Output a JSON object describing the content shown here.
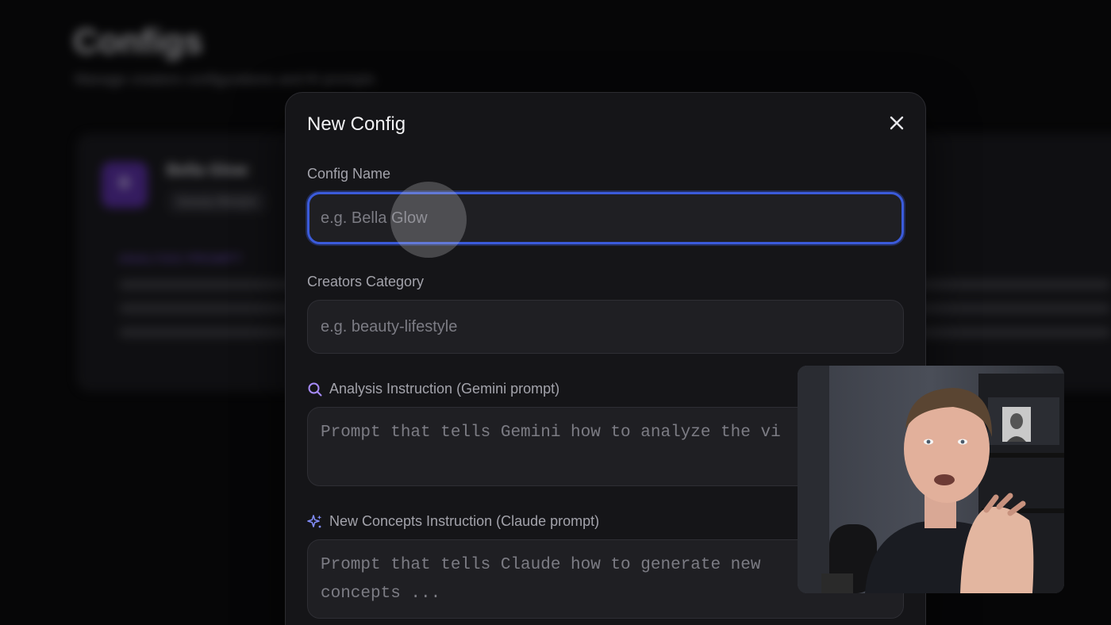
{
  "background": {
    "title": "Configs",
    "subtitle": "Manage creators configurations and AI prompts",
    "card": {
      "avatar_letter": "B",
      "name": "Bella Glow",
      "tag": "beauty-lifestyle",
      "section_label": "ANALYSIS PROMPT"
    }
  },
  "modal": {
    "title": "New Config",
    "fields": {
      "config_name": {
        "label": "Config Name",
        "placeholder": "e.g. Bella Glow",
        "value": ""
      },
      "creators_category": {
        "label": "Creators Category",
        "placeholder": "e.g. beauty-lifestyle",
        "value": ""
      },
      "analysis_instruction": {
        "label": "Analysis Instruction (Gemini prompt)",
        "placeholder": "Prompt that tells Gemini how to analyze the vi",
        "icon": "search-icon",
        "value": ""
      },
      "concepts_instruction": {
        "label": "New Concepts Instruction (Claude prompt)",
        "placeholder": "Prompt that tells Claude how to generate new\nconcepts ...",
        "icon": "sparkles-icon",
        "value": ""
      }
    }
  },
  "colors": {
    "focus_ring": "#3b5bdb",
    "accent_purple": "#a78bfa",
    "accent_blue": "#818cf8",
    "modal_bg": "#151518",
    "input_bg": "#1f1f23"
  }
}
